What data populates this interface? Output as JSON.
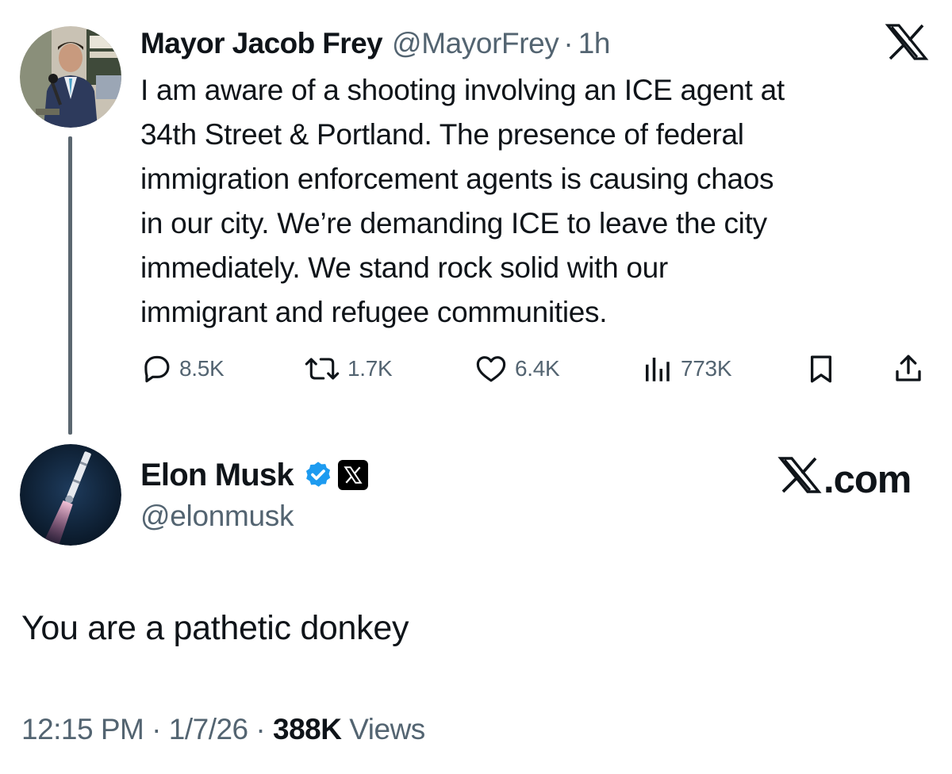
{
  "original_tweet": {
    "author_name": "Mayor Jacob Frey",
    "handle": "@MayorFrey",
    "separator": "·",
    "time": "1h",
    "text": "I am aware of a shooting involving an ICE agent at\n34th Street & Portland. The presence of federal\nimmigration enforcement agents is causing chaos\nin our city. We’re demanding ICE to leave the city\nimmediately. We stand rock solid with our\nimmigrant and refugee communities.",
    "actions": {
      "replies": "8.5K",
      "reposts": "1.7K",
      "likes": "6.4K",
      "views": "773K"
    }
  },
  "reply_tweet": {
    "author_name": "Elon Musk",
    "handle": "@elonmusk",
    "text": "You are a pathetic donkey",
    "time": "12:15 PM",
    "date": "1/7/26",
    "separator": "·",
    "views_count": "388K",
    "views_label": "Views"
  },
  "branding": {
    "logo_icon": "x-logo-icon",
    "site_label": ".com"
  },
  "colors": {
    "text_primary": "#0f1419",
    "text_secondary": "#536471",
    "thread_line": "#5b6770",
    "verified_blue": "#1d9bf0"
  }
}
